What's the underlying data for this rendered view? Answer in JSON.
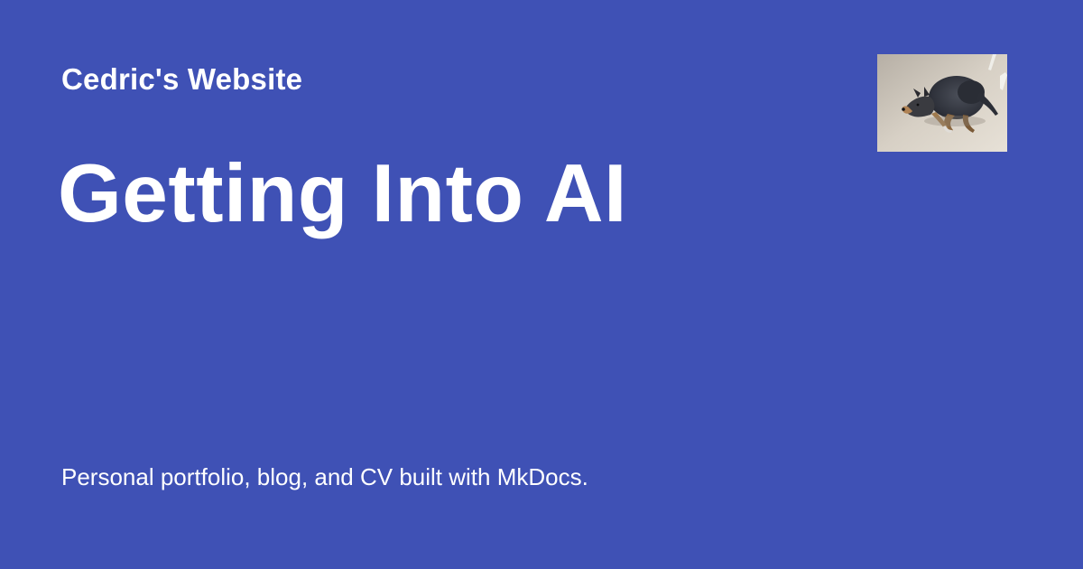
{
  "site": {
    "name": "Cedric's Website"
  },
  "page": {
    "title": "Getting Into AI",
    "description": "Personal portfolio, blog, and CV built with MkDocs."
  },
  "logo": {
    "icon": "dog-photo-logo"
  },
  "colors": {
    "background": "#3f51b5",
    "text": "#ffffff"
  }
}
